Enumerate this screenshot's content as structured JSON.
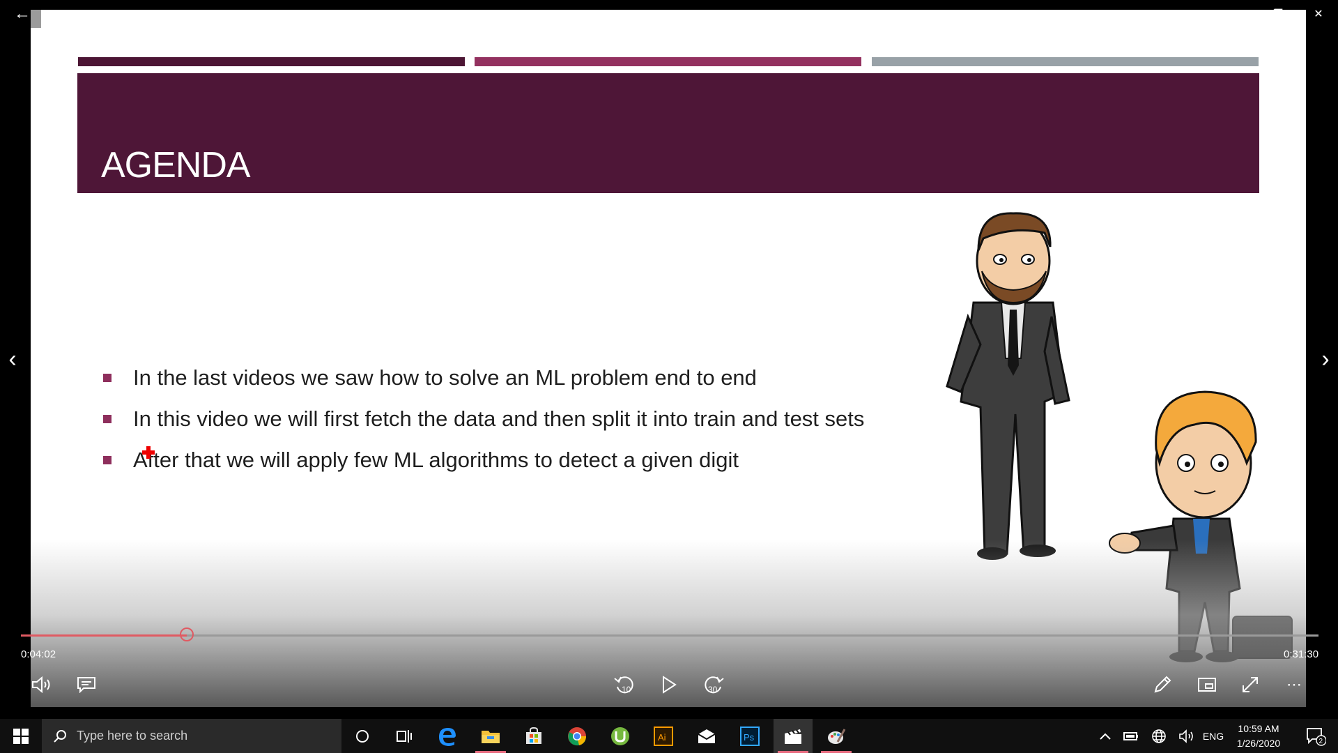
{
  "slide": {
    "title": "AGENDA",
    "bullets": [
      "In the last videos we saw how to solve an ML problem end to end",
      "In this video we will first fetch the data and then split it into train and test sets",
      "After that we will apply few ML algorithms to detect a given digit"
    ],
    "colors": {
      "dark": "#4e1637",
      "accent": "#93315f",
      "grey": "#98a1a7"
    }
  },
  "player": {
    "current_time": "0:04:02",
    "total_time": "0:31:30",
    "progress_fraction": 0.128,
    "skip_back_label": "10",
    "skip_forward_label": "30",
    "accent_color": "#e05a62"
  },
  "taskbar": {
    "search_placeholder": "Type here to search",
    "language": "ENG",
    "time": "10:59 AM",
    "date": "1/26/2020",
    "notification_count": "2",
    "apps": [
      "cortana-icon",
      "task-view-icon",
      "edge-icon",
      "file-explorer-icon",
      "store-icon",
      "chrome-icon",
      "utorrent-icon",
      "illustrator-icon",
      "mail-icon",
      "photoshop-icon",
      "movies-tv-icon",
      "paint-icon"
    ]
  }
}
